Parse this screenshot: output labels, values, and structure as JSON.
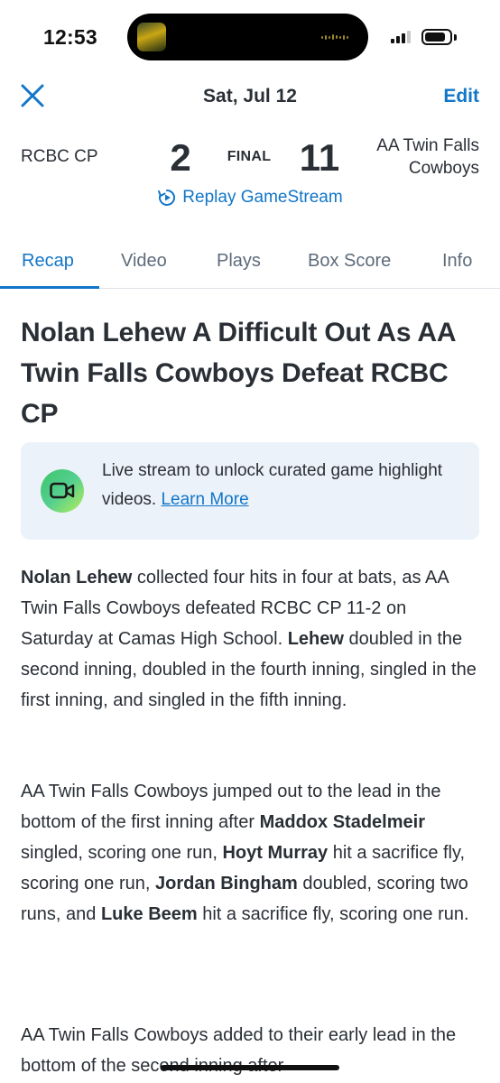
{
  "status_bar": {
    "time": "12:53"
  },
  "header": {
    "date": "Sat, Jul 12",
    "edit_label": "Edit",
    "close_icon": "close-icon"
  },
  "scoreboard": {
    "away_team": "RCBC CP",
    "away_score": "2",
    "status": "FINAL",
    "home_score": "11",
    "home_team_line1": "AA Twin Falls",
    "home_team_line2": "Cowboys",
    "replay_label": "Replay GameStream"
  },
  "tabs": [
    {
      "label": "Recap",
      "active": true
    },
    {
      "label": "Video",
      "active": false
    },
    {
      "label": "Plays",
      "active": false
    },
    {
      "label": "Box Score",
      "active": false
    },
    {
      "label": "Info",
      "active": false
    }
  ],
  "article": {
    "headline": "Nolan Lehew A Difficult Out As AA Twin Falls Cowboys Defeat RCBC CP",
    "promo": {
      "text": "Live stream to unlock curated game highlight videos.",
      "link": "Learn More"
    },
    "p1": {
      "b1": "Nolan Lehew",
      "t1": " collected four hits in four at bats, as AA Twin Falls Cowboys defeated RCBC CP 11-2 on Saturday at Camas High School. ",
      "b2": "Lehew",
      "t2": " doubled in the second inning, doubled in the fourth inning, singled in the first inning, and singled in the fifth inning."
    },
    "p2": {
      "t1": "AA Twin Falls Cowboys jumped out to the lead in the bottom of the first inning after ",
      "b1": "Maddox Stadelmeir",
      "t2": " singled, scoring one run, ",
      "b2": "Hoyt Murray",
      "t3": " hit a sacrifice fly, scoring one run, ",
      "b3": "Jordan Bingham",
      "t4": " doubled, scoring two runs, and ",
      "b4": "Luke Beem",
      "t5": " hit a sacrifice fly, scoring one run."
    },
    "p3": {
      "t1": "AA Twin Falls Cowboys added to their early lead in the bottom of the second inning after"
    }
  },
  "colors": {
    "accent": "#1276c9",
    "text": "#2a2f36",
    "tab_inactive": "#5d6b7a",
    "promo_bg": "#ebf2f9"
  }
}
